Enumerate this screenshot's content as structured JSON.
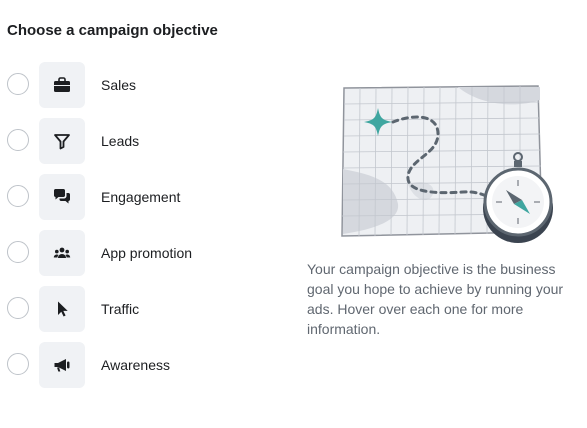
{
  "header": {
    "title": "Choose a campaign objective"
  },
  "objectives": [
    {
      "label": "Sales",
      "icon": "briefcase-icon"
    },
    {
      "label": "Leads",
      "icon": "funnel-icon"
    },
    {
      "label": "Engagement",
      "icon": "chat-bubbles-icon"
    },
    {
      "label": "App promotion",
      "icon": "people-icon"
    },
    {
      "label": "Traffic",
      "icon": "cursor-icon"
    },
    {
      "label": "Awareness",
      "icon": "megaphone-icon"
    }
  ],
  "description": "Your campaign objective is the business goal you hope to achieve by running your ads. Hover over each one for more information.",
  "colors": {
    "icon": "#1c1e21",
    "icon_bg": "#f0f2f5",
    "radio_border": "#bec3c9",
    "description_text": "#606770",
    "illustration_accent": "#3fa6a0"
  }
}
